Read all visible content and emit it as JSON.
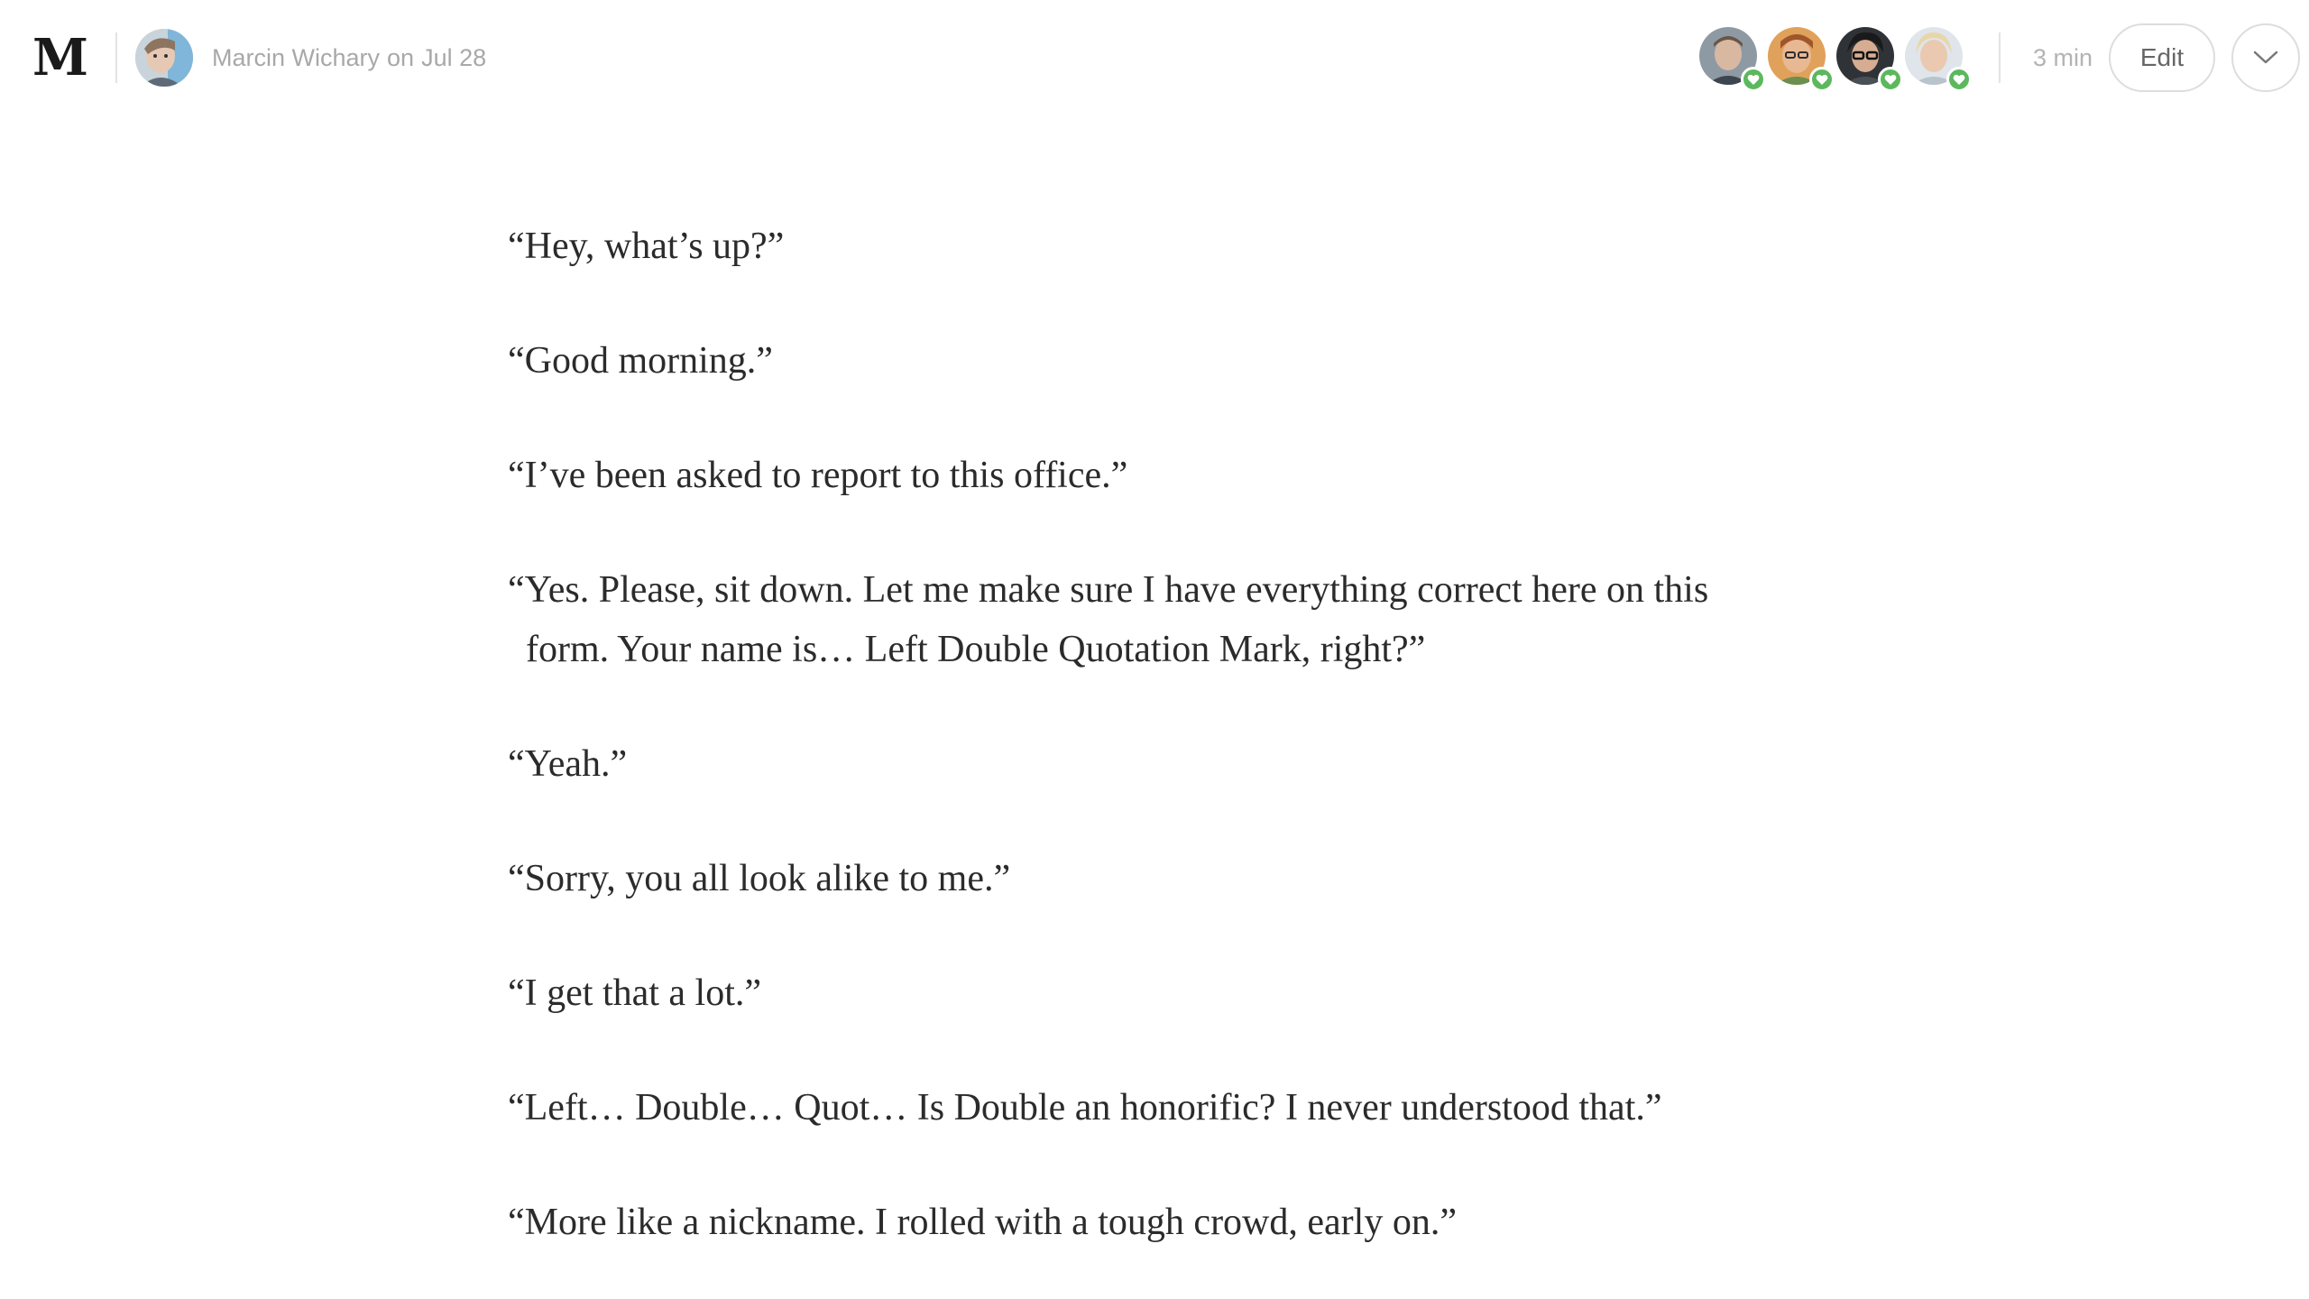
{
  "app": {
    "logo": "M"
  },
  "header": {
    "author_name": "Marcin Wichary",
    "byline_joiner": "on",
    "date": "Jul 28",
    "read_time": "3 min",
    "edit_label": "Edit",
    "more_icon": "chevron-down-icon",
    "recommender_count": 4
  },
  "colors": {
    "heart_badge": "#5cb85c",
    "text": "#2b2b2b",
    "meta_text": "#a8a8a8"
  },
  "article": {
    "paragraphs": [
      "“Hey, what’s up?”",
      "“Good morning.”",
      "“I’ve been asked to report to this office.”",
      "“Yes. Please, sit down. Let me make sure I have everything correct here on this form. Your name is… Left Double Quotation Mark, right?”",
      "“Yeah.”",
      "“Sorry, you all look alike to me.”",
      "“I get that a lot.”",
      "“Left… Double… Quot… Is Double an honorific? I never understood that.”",
      "“More like a nickname. I rolled with a tough crowd, early on.”"
    ]
  }
}
